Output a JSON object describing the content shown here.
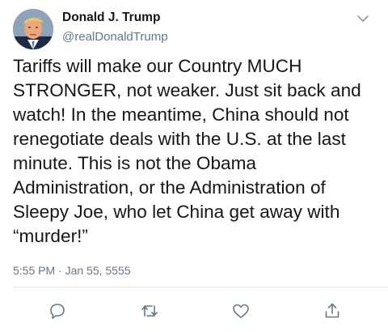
{
  "author": {
    "display_name": "Donald J. Trump",
    "handle": "@realDonaldTrump",
    "avatar_icon": "profile-photo"
  },
  "tweet": {
    "text": "Tariffs will make our Country MUCH\nSTRONGER, not weaker. Just sit back and\nwatch! In the meantime, China should not\nrenegotiate deals with the U.S. at the last\nminute. This is not the Obama\nAdministration, or the Administration of\nSleepy Joe, who let China get away with\n“murder!”",
    "timestamp": "5:55 PM · Jan 55, 5555"
  },
  "actions": [
    {
      "name": "reply",
      "icon": "reply-icon"
    },
    {
      "name": "retweet",
      "icon": "retweet-icon"
    },
    {
      "name": "like",
      "icon": "heart-icon"
    },
    {
      "name": "share",
      "icon": "share-icon"
    }
  ],
  "colors": {
    "text": "#14171a",
    "secondary": "#657786",
    "divider": "#e1e8ed",
    "icon": "#657786"
  }
}
